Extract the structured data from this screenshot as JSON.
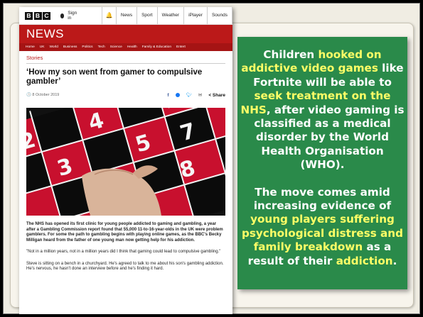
{
  "news": {
    "logo": [
      "B",
      "B",
      "C"
    ],
    "signin": "Sign in",
    "top_nav": [
      "News",
      "Sport",
      "Weather",
      "iPlayer",
      "Sounds"
    ],
    "section": "NEWS",
    "sub_nav": [
      "Home",
      "UK",
      "World",
      "Business",
      "Politics",
      "Tech",
      "Science",
      "Health",
      "Family & Education",
      "Entert"
    ],
    "breadcrumb": "Stories",
    "headline": "‘How my son went from gamer to compulsive gambler’",
    "date": "8 October 2019",
    "share": "Share",
    "paragraphs": [
      "The NHS has opened its first clinic for young people addicted to gaming and gambling, a year after a Gambling Commission report found that 55,000 11-to-16-year-olds in the UK were problem gamblers. For some the path to gambling begins with playing online games, as the BBC's Becky Milligan heard from the father of one young man now getting help for his addiction.",
      "\"Not in a million years, not in a million years did I think that gaming could lead to compulsive gambling.\"",
      "Steve is sitting on a bench in a churchyard. He's agreed to talk to me about his son's gambling addiction. He's nervous, he hasn't done an interview before and he's finding it hard."
    ]
  },
  "callout": {
    "p1": [
      {
        "t": "Children ",
        "y": false
      },
      {
        "t": "hooked on addictive video games",
        "y": true
      },
      {
        "t": " like Fortnite will be able to ",
        "y": false
      },
      {
        "t": "seek treatment on the NHS",
        "y": true
      },
      {
        "t": ", after video gaming is classified as a medical disorder by the World Health Organisation (WHO).",
        "y": false
      }
    ],
    "p2": [
      {
        "t": "The move comes amid increasing evidence of ",
        "y": false
      },
      {
        "t": "young players suffering psychological distress and family breakdown",
        "y": true
      },
      {
        "t": " as a result of their ",
        "y": false
      },
      {
        "t": "addiction",
        "y": true
      },
      {
        "t": ".",
        "y": false
      }
    ]
  },
  "colors": {
    "bbc_red": "#bb1919",
    "callout_green": "#2a8a4a",
    "highlight": "#ffff66"
  }
}
